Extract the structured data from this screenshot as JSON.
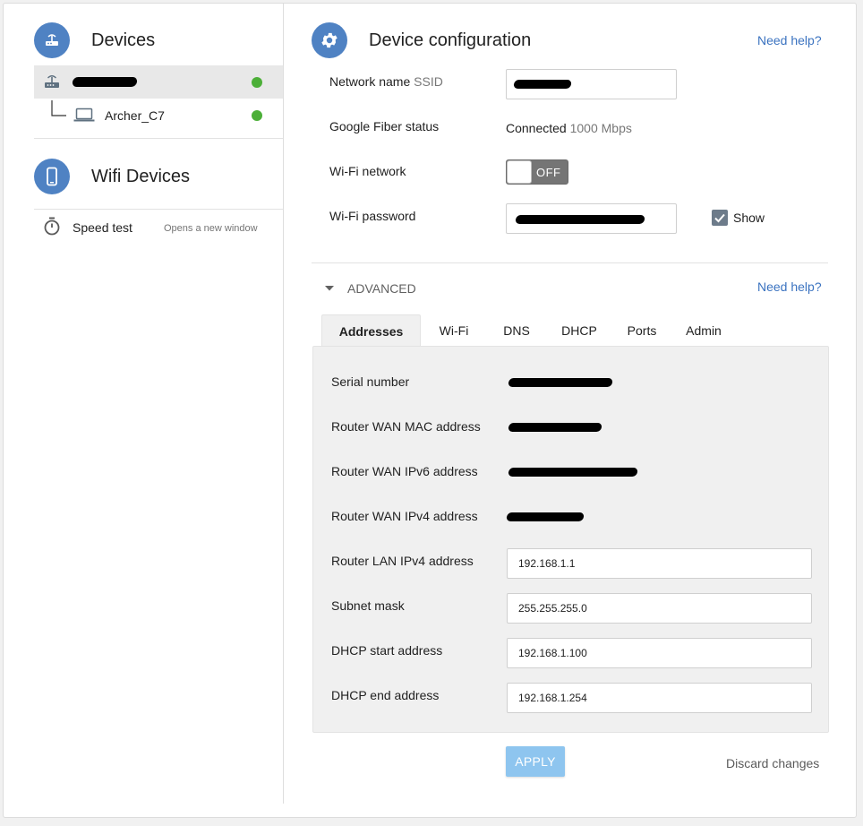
{
  "sidebar": {
    "devices_title": "Devices",
    "router_name_redacted": "",
    "child_device_name": "Archer_C7",
    "wifi_devices_title": "Wifi Devices",
    "speed_test_label": "Speed test",
    "speed_test_hint": "Opens a new window"
  },
  "config": {
    "title": "Device configuration",
    "help_link": "Need help?",
    "network_name_label": "Network name",
    "network_name_sub": "SSID",
    "fiber_status_label": "Google Fiber status",
    "fiber_status_value": "Connected",
    "fiber_speed": "1000 Mbps",
    "wifi_network_label": "Wi-Fi network",
    "wifi_toggle_state": "OFF",
    "wifi_password_label": "Wi-Fi password",
    "show_label": "Show"
  },
  "advanced": {
    "title": "ADVANCED",
    "help_link": "Need help?",
    "tabs": [
      {
        "label": "Addresses"
      },
      {
        "label": "Wi-Fi"
      },
      {
        "label": "DNS"
      },
      {
        "label": "DHCP"
      },
      {
        "label": "Ports"
      },
      {
        "label": "Admin"
      }
    ],
    "fields": {
      "serial_label": "Serial number",
      "wan_mac_label": "Router WAN MAC address",
      "wan_ipv6_label": "Router WAN IPv6 address",
      "wan_ipv4_label": "Router WAN IPv4 address",
      "lan_ipv4_label": "Router LAN IPv4 address",
      "lan_ipv4_value": "192.168.1.1",
      "subnet_label": "Subnet mask",
      "subnet_value": "255.255.255.0",
      "dhcp_start_label": "DHCP start address",
      "dhcp_start_value": "192.168.1.100",
      "dhcp_end_label": "DHCP end address",
      "dhcp_end_value": "192.168.1.254"
    }
  },
  "actions": {
    "apply": "APPLY",
    "discard": "Discard changes"
  },
  "colors": {
    "accent": "#4f82c3",
    "online": "#4caf38",
    "link": "#3b73c0",
    "apply_button": "#8ec5ef"
  }
}
